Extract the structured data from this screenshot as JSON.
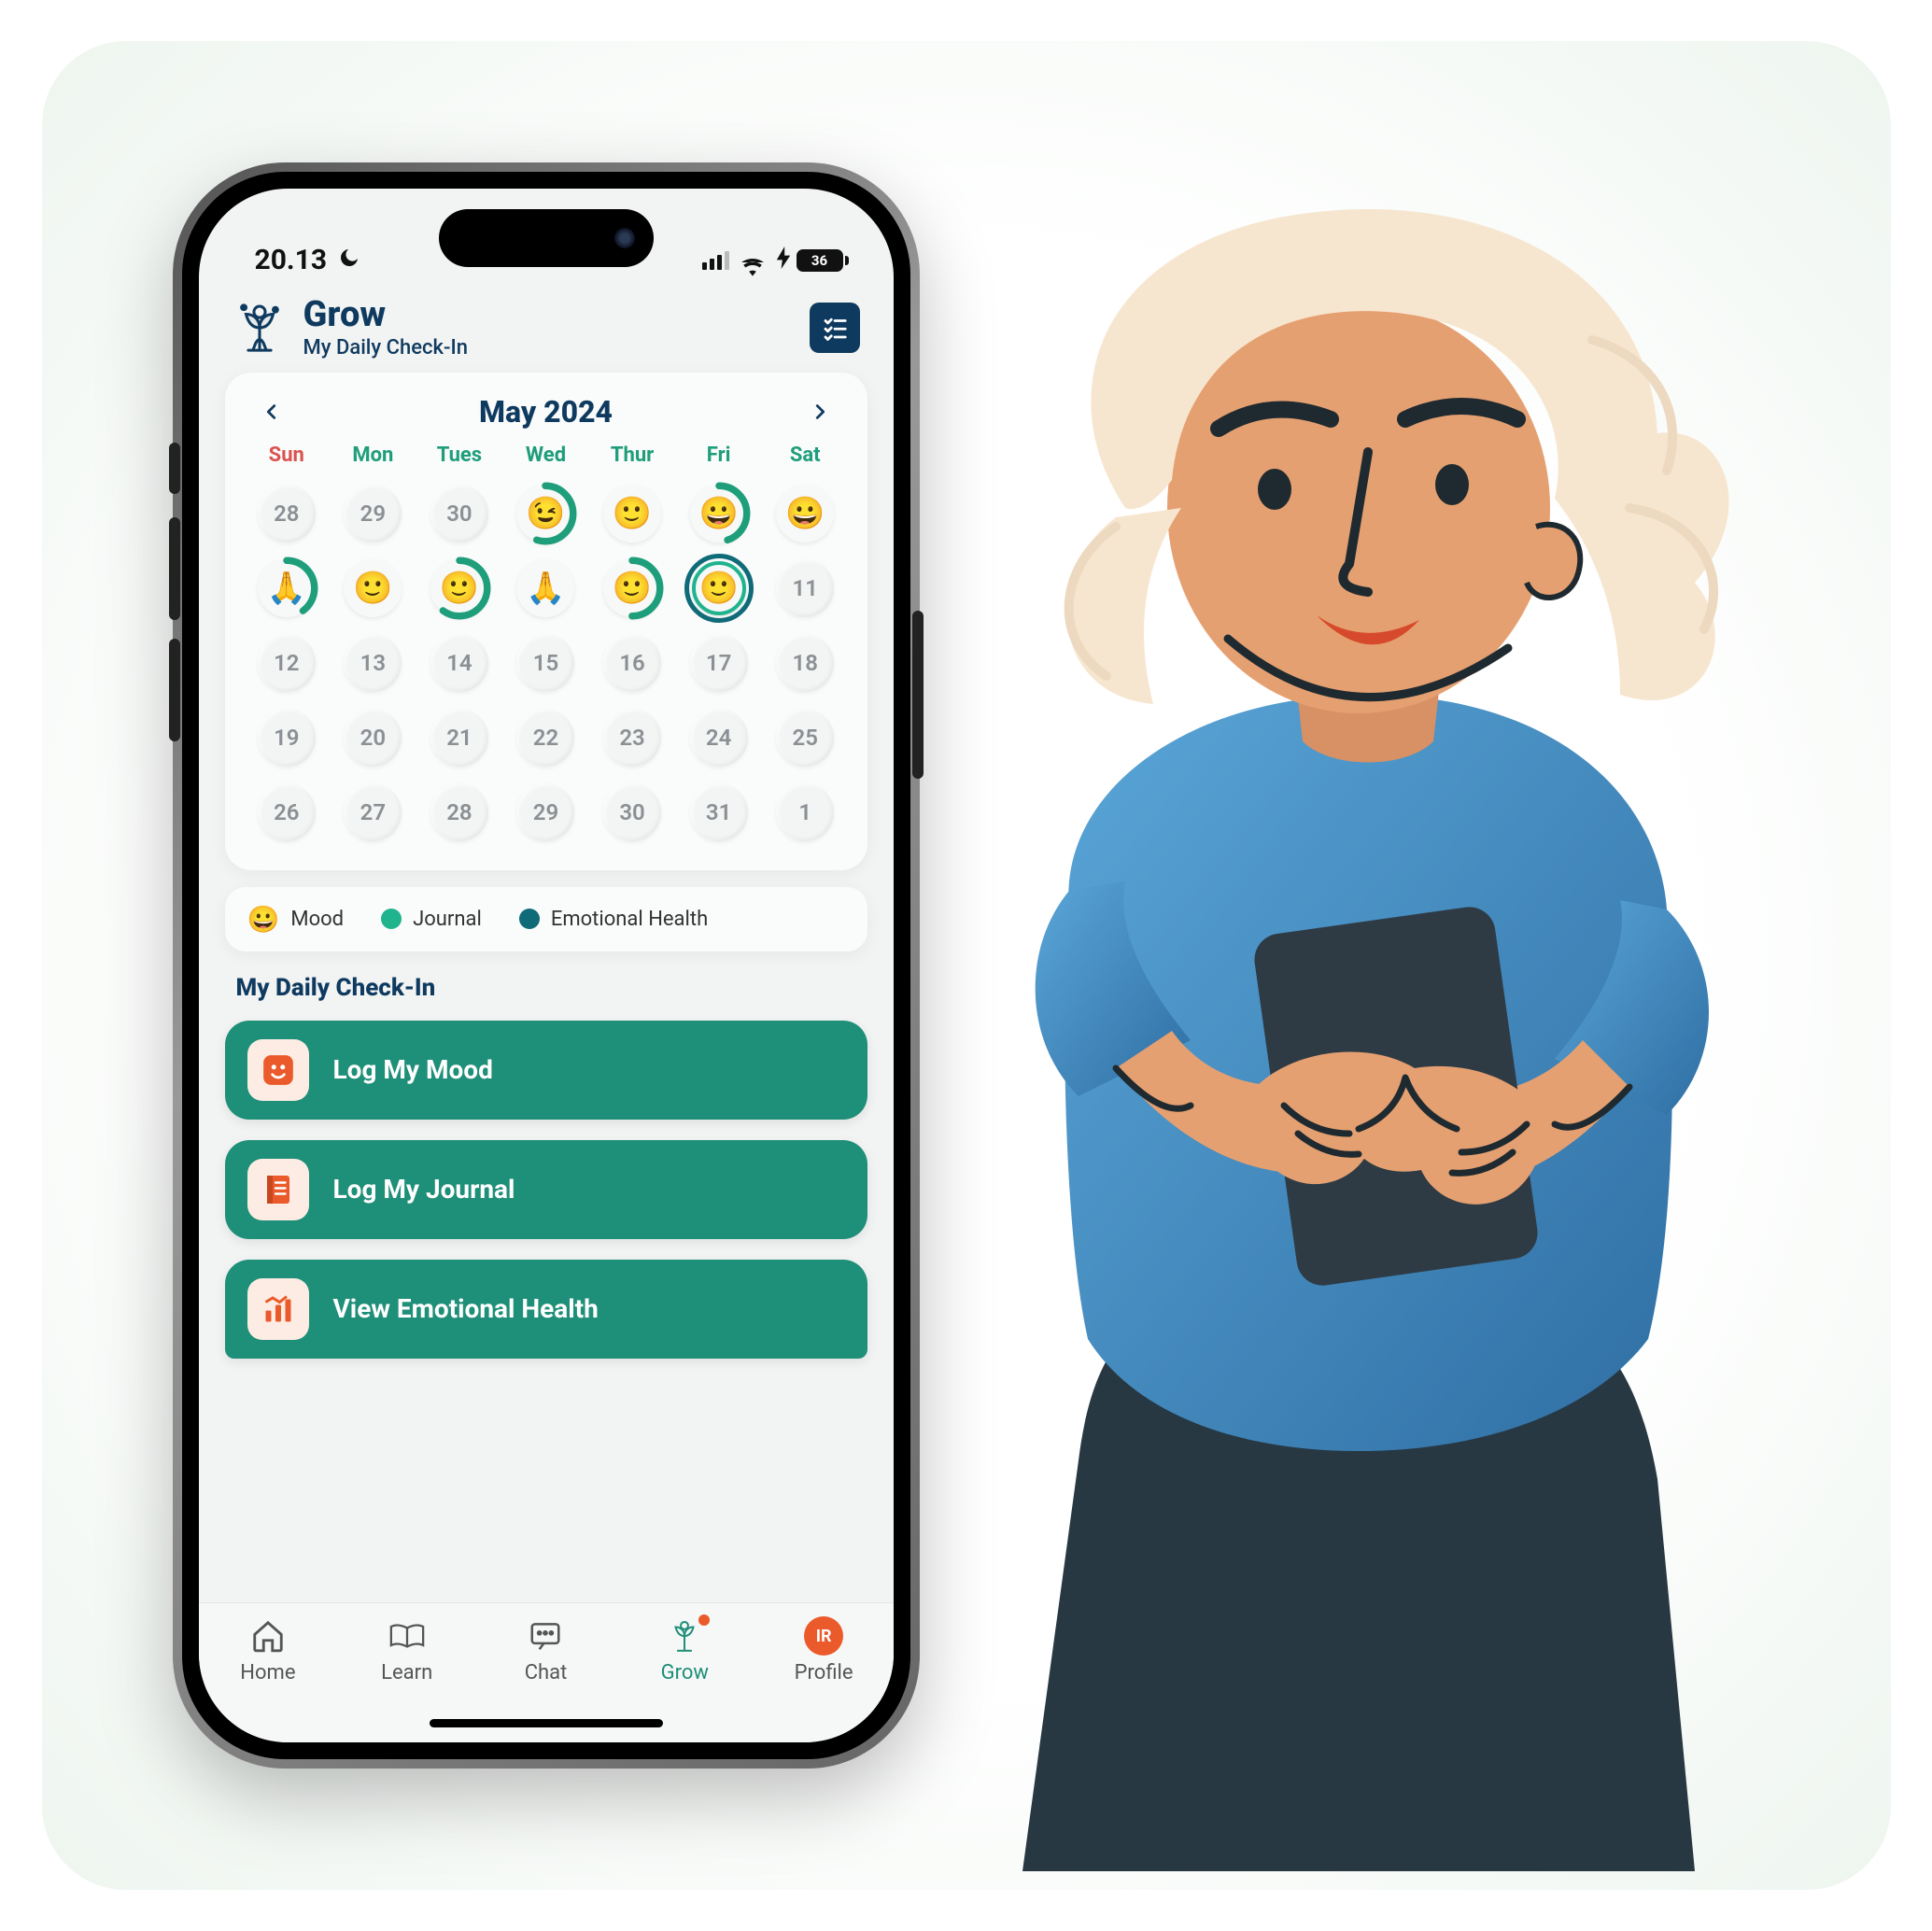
{
  "status": {
    "time": "20.13",
    "battery": "36"
  },
  "header": {
    "title": "Grow",
    "subtitle": "My Daily Check-In"
  },
  "calendar": {
    "title": "May 2024",
    "dow": [
      "Sun",
      "Mon",
      "Tues",
      "Wed",
      "Thur",
      "Fri",
      "Sat"
    ],
    "weeks": [
      [
        {
          "n": "28"
        },
        {
          "n": "29"
        },
        {
          "n": "30"
        },
        {
          "emoji": "😉",
          "ring": 55
        },
        {
          "emoji": "🙂"
        },
        {
          "emoji": "😀",
          "ring": 45
        },
        {
          "emoji": "😀"
        }
      ],
      [
        {
          "emoji": "🙏",
          "ring": 40
        },
        {
          "emoji": "🙂"
        },
        {
          "emoji": "🙂",
          "ring": 60
        },
        {
          "emoji": "🙏"
        },
        {
          "emoji": "🙂",
          "ring": 50
        },
        {
          "emoji": "🙂",
          "ring": 100,
          "selected": true
        },
        {
          "n": "11"
        }
      ],
      [
        {
          "n": "12"
        },
        {
          "n": "13"
        },
        {
          "n": "14"
        },
        {
          "n": "15"
        },
        {
          "n": "16"
        },
        {
          "n": "17"
        },
        {
          "n": "18"
        }
      ],
      [
        {
          "n": "19"
        },
        {
          "n": "20"
        },
        {
          "n": "21"
        },
        {
          "n": "22"
        },
        {
          "n": "23"
        },
        {
          "n": "24"
        },
        {
          "n": "25"
        }
      ],
      [
        {
          "n": "26"
        },
        {
          "n": "27"
        },
        {
          "n": "28"
        },
        {
          "n": "29"
        },
        {
          "n": "30"
        },
        {
          "n": "31"
        },
        {
          "n": "1"
        }
      ]
    ]
  },
  "legend": {
    "mood": "Mood",
    "journal": "Journal",
    "emo": "Emotional Health"
  },
  "section": {
    "title": "My Daily Check-In"
  },
  "actions": {
    "mood": "Log My Mood",
    "journal": "Log My Journal",
    "emo": "View Emotional Health"
  },
  "nav": {
    "home": "Home",
    "learn": "Learn",
    "chat": "Chat",
    "grow": "Grow",
    "profile": "Profile",
    "avatar": "IR"
  }
}
